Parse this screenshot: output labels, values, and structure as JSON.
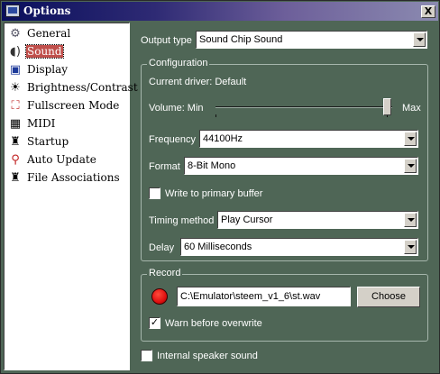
{
  "window": {
    "title": "Options",
    "close_label": "X"
  },
  "nav": {
    "items": [
      {
        "label": "General",
        "icon": "general-icon",
        "glyph": "🖥"
      },
      {
        "label": "Sound",
        "icon": "speaker-icon",
        "glyph": "🔈",
        "selected": true
      },
      {
        "label": "Display",
        "icon": "monitor-icon",
        "glyph": "▣"
      },
      {
        "label": "Brightness/Contrast",
        "icon": "sun-icon",
        "glyph": "☀"
      },
      {
        "label": "Fullscreen Mode",
        "icon": "fullscreen-icon",
        "glyph": "⛶"
      },
      {
        "label": "MIDI",
        "icon": "midi-keyboard-icon",
        "glyph": "▦"
      },
      {
        "label": "Startup",
        "icon": "joystick-icon",
        "glyph": "♜"
      },
      {
        "label": "Auto Update",
        "icon": "pushpin-icon",
        "glyph": "📌"
      },
      {
        "label": "File Associations",
        "icon": "joystick-icon",
        "glyph": "♜"
      }
    ]
  },
  "sound": {
    "output_type_label": "Output type",
    "output_type_value": "Sound Chip Sound",
    "configuration": {
      "title": "Configuration",
      "current_driver": "Current driver: Default",
      "volume_min_label": "Volume: Min",
      "volume_max_label": "Max",
      "volume_level": 0.97,
      "frequency_label": "Frequency",
      "frequency_value": "44100Hz",
      "format_label": "Format",
      "format_value": "8-Bit Mono",
      "write_primary_label": "Write to primary buffer",
      "write_primary_checked": false,
      "timing_method_label": "Timing method",
      "timing_method_value": "Play Cursor",
      "delay_label": "Delay",
      "delay_value": "60 Milliseconds"
    },
    "record": {
      "title": "Record",
      "path": "C:\\Emulator\\steem_v1_6\\st.wav",
      "choose_label": "Choose",
      "warn_label": "Warn before overwrite",
      "warn_checked": true
    },
    "internal_speaker_label": "Internal speaker sound",
    "internal_speaker_checked": false
  },
  "colors": {
    "background": "#4f6656",
    "selection": "#c0504c",
    "record": "#e01010"
  }
}
